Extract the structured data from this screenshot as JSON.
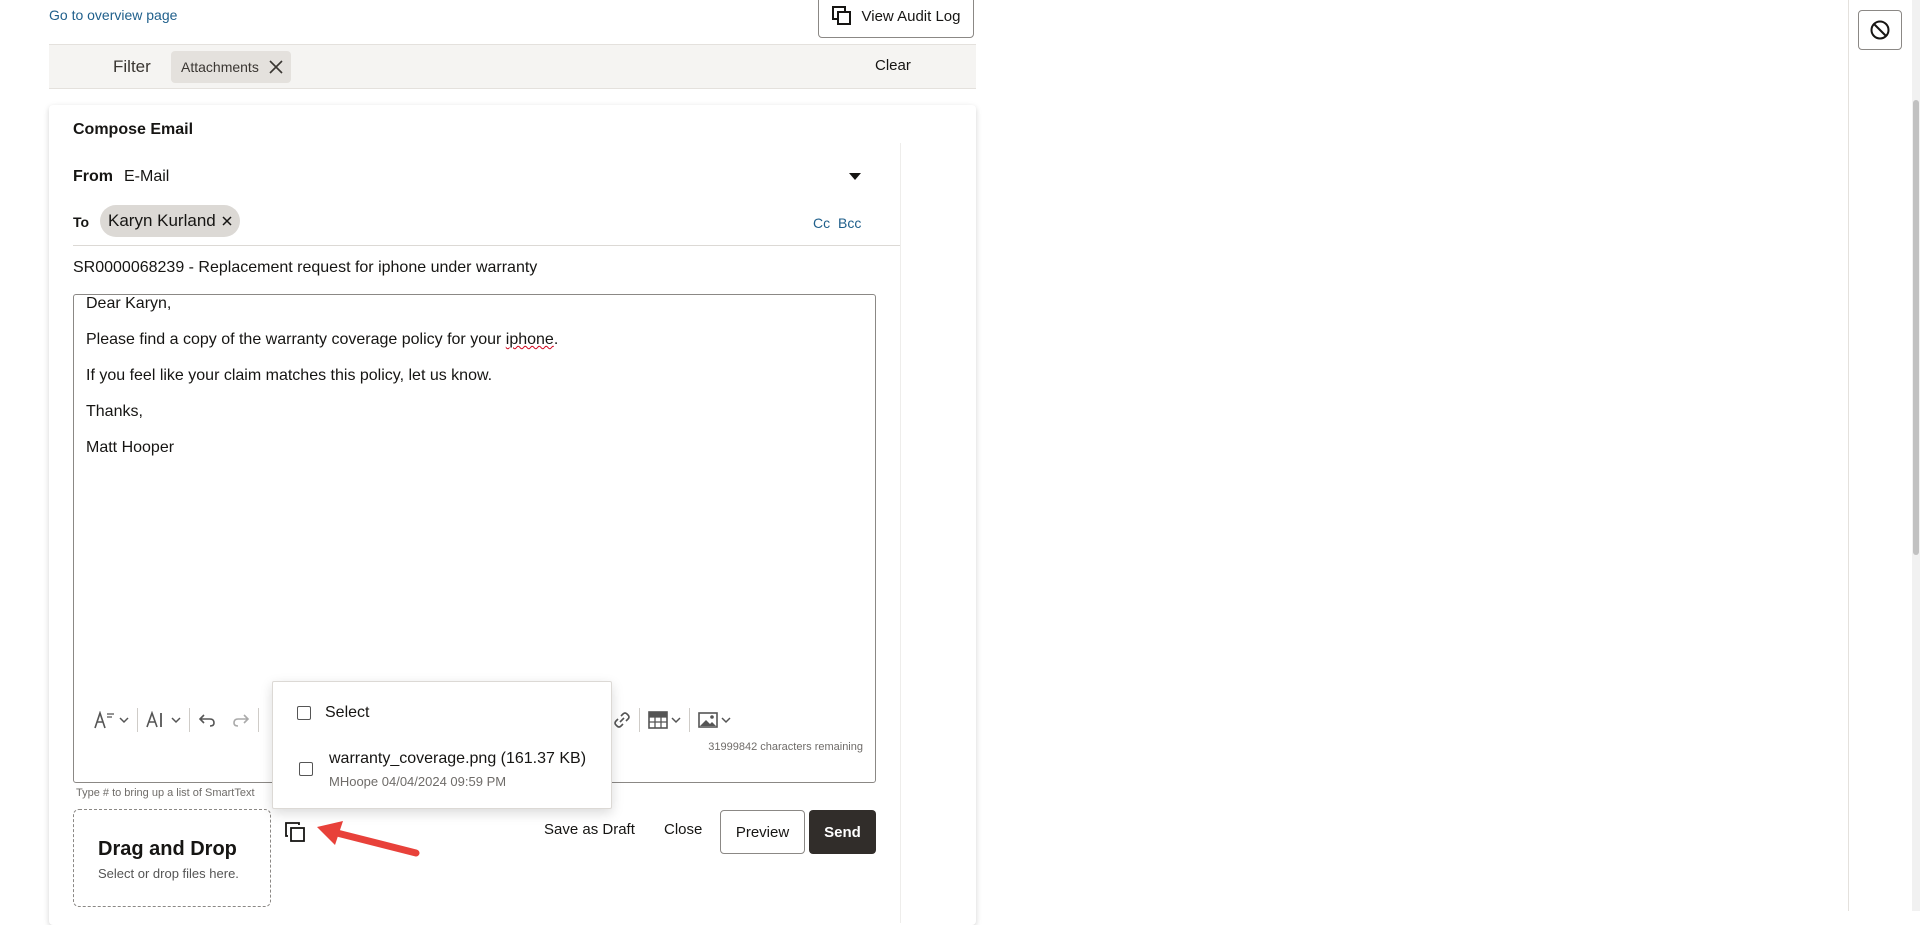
{
  "page": {
    "overview_link": "Go to overview page",
    "audit_log_label": "View Audit Log"
  },
  "filter": {
    "label": "Filter",
    "chip_label": "Attachments",
    "clear_label": "Clear"
  },
  "compose": {
    "title": "Compose Email",
    "from_label": "From",
    "from_value": "E-Mail",
    "to_label": "To",
    "recipient": "Karyn Kurland",
    "cc_label": "Cc",
    "bcc_label": "Bcc",
    "subject": "SR0000068239 - Replacement request for iphone under warranty",
    "body": {
      "line1": "Dear Karyn,",
      "line2_pre": "Please find a copy of the warranty coverage policy for your ",
      "line2_word": "iphone",
      "line2_post": ".",
      "line3": "If you feel like your claim matches this policy, let us know.",
      "line4": "Thanks,",
      "line5": "Matt Hooper"
    },
    "chars_remaining": "31999842 characters remaining",
    "smarttext_hint": "Type # to bring up a list of SmartText"
  },
  "dropzone": {
    "title": "Drag and Drop",
    "subtitle": "Select or drop files here."
  },
  "actions": {
    "save_draft": "Save as Draft",
    "close": "Close",
    "preview": "Preview",
    "send": "Send"
  },
  "popup": {
    "select_label": "Select",
    "file_name": "warranty_coverage.png (161.37 KB)",
    "file_meta": "MHoope 04/04/2024 09:59 PM"
  },
  "colors": {
    "link": "#1f5f8b",
    "send_bg": "#312d2a",
    "annotation_arrow": "#e8413a"
  }
}
